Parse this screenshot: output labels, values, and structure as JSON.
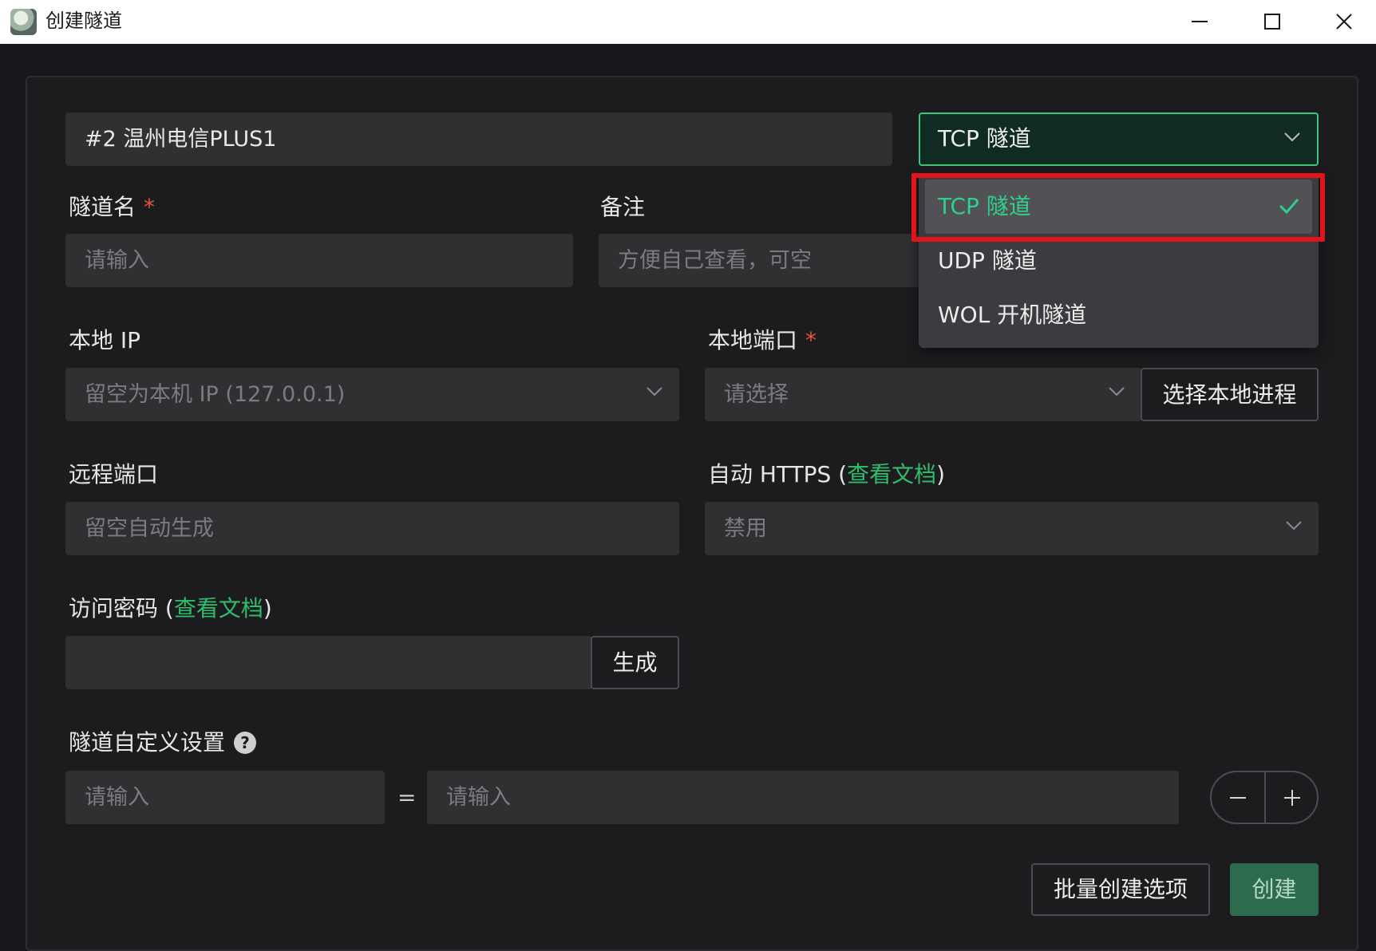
{
  "window": {
    "title": "创建隧道"
  },
  "node_field": {
    "value": "#2 温州电信PLUS1"
  },
  "tunnel_type": {
    "selected": "TCP 隧道",
    "options": [
      "TCP 隧道",
      "UDP 隧道",
      "WOL 开机隧道"
    ]
  },
  "tunnel_name": {
    "label": "隧道名",
    "required_mark": "*",
    "placeholder": "请输入"
  },
  "remark": {
    "label": "备注",
    "placeholder": "方便自己查看，可空"
  },
  "local_ip": {
    "label": "本地 IP",
    "placeholder": "留空为本机 IP (127.0.0.1)"
  },
  "local_port": {
    "label": "本地端口",
    "required_mark": "*",
    "placeholder": "请选择",
    "select_process_label": "选择本地进程"
  },
  "remote_port": {
    "label": "远程端口",
    "placeholder": "留空自动生成"
  },
  "auto_https": {
    "label_prefix": "自动 HTTPS (",
    "doc_link": "查看文档",
    "label_suffix": ")",
    "value": "禁用"
  },
  "access_password": {
    "label_prefix": "访问密码 (",
    "doc_link": "查看文档",
    "label_suffix": ")",
    "value": "",
    "generate_label": "生成"
  },
  "custom_settings": {
    "label": "隧道自定义设置",
    "help_glyph": "?",
    "key_placeholder": "请输入",
    "equals": "=",
    "value_placeholder": "请输入"
  },
  "footer": {
    "batch_label": "批量创建选项",
    "create_label": "创建"
  },
  "colors": {
    "accent": "#2ebd6b",
    "highlight": "#e0141b",
    "required": "#e5553d"
  }
}
